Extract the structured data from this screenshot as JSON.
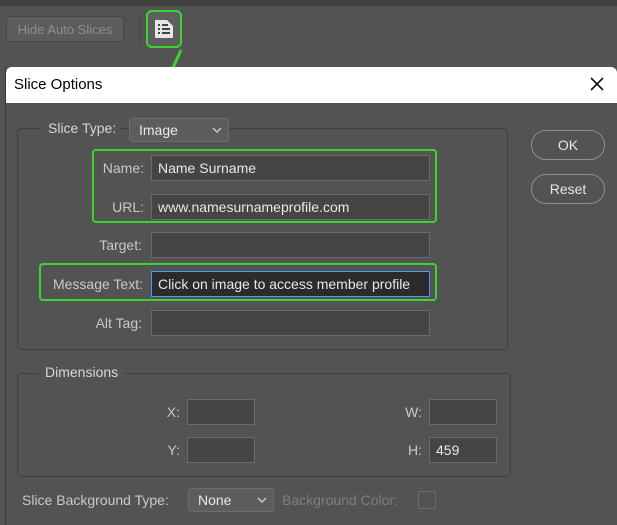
{
  "toolbar": {
    "hide_auto_slices_label": "Hide Auto Slices",
    "slice_options_icon": "slice-options-icon"
  },
  "dialog": {
    "title": "Slice Options",
    "ok_label": "OK",
    "reset_label": "Reset",
    "slice_type_label": "Slice Type:",
    "slice_type_value": "Image",
    "fields": {
      "name_label": "Name:",
      "name_value": "Name Surname",
      "url_label": "URL:",
      "url_value": "www.namesurnameprofile.com",
      "target_label": "Target:",
      "target_value": "",
      "message_label": "Message Text:",
      "message_value": "Click on image to access member profile",
      "alt_label": "Alt Tag:",
      "alt_value": ""
    },
    "dimensions": {
      "legend": "Dimensions",
      "x_label": "X:",
      "x_value": "",
      "y_label": "Y:",
      "y_value": "",
      "w_label": "W:",
      "w_value": "",
      "h_label": "H:",
      "h_value": "459"
    },
    "bg_type_label": "Slice Background Type:",
    "bg_type_value": "None",
    "bg_color_label": "Background Color:"
  },
  "colors": {
    "highlight": "#39d42d",
    "panel": "#535353",
    "focus": "#4d9bf0"
  }
}
